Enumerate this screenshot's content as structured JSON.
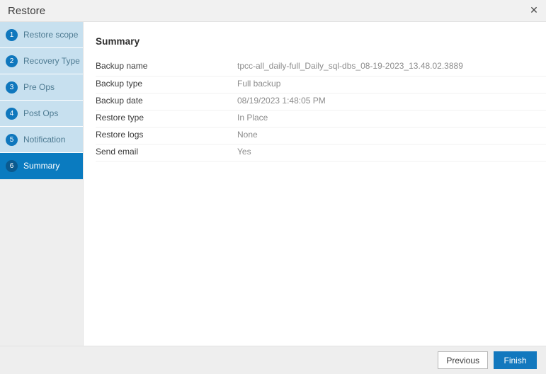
{
  "dialog": {
    "title": "Restore",
    "close_icon": "close-icon",
    "close_glyph": "✕"
  },
  "sidebar": {
    "steps": [
      {
        "number": "1",
        "label": "Restore scope",
        "active": false
      },
      {
        "number": "2",
        "label": "Recovery Type",
        "active": false
      },
      {
        "number": "3",
        "label": "Pre Ops",
        "active": false
      },
      {
        "number": "4",
        "label": "Post Ops",
        "active": false
      },
      {
        "number": "5",
        "label": "Notification",
        "active": false
      },
      {
        "number": "6",
        "label": "Summary",
        "active": true
      }
    ]
  },
  "content": {
    "heading": "Summary",
    "rows": [
      {
        "key": "Backup name",
        "value": "tpcc-all_daily-full_Daily_sql-dbs_08-19-2023_13.48.02.3889"
      },
      {
        "key": "Backup type",
        "value": "Full backup"
      },
      {
        "key": "Backup date",
        "value": "08/19/2023 1:48:05 PM"
      },
      {
        "key": "Restore type",
        "value": "In Place"
      },
      {
        "key": "Restore logs",
        "value": "None"
      },
      {
        "key": "Send email",
        "value": "Yes"
      }
    ]
  },
  "footer": {
    "previous_label": "Previous",
    "finish_label": "Finish"
  },
  "colors": {
    "accent": "#1278be",
    "step_active_bg": "#0a7bc0",
    "step_bg": "#c7e0ef",
    "badge": "#0f77bd",
    "badge_active": "#0b5a8f",
    "chrome_bg": "#eeeeee",
    "titlebar_bg": "#f1f1f1"
  }
}
